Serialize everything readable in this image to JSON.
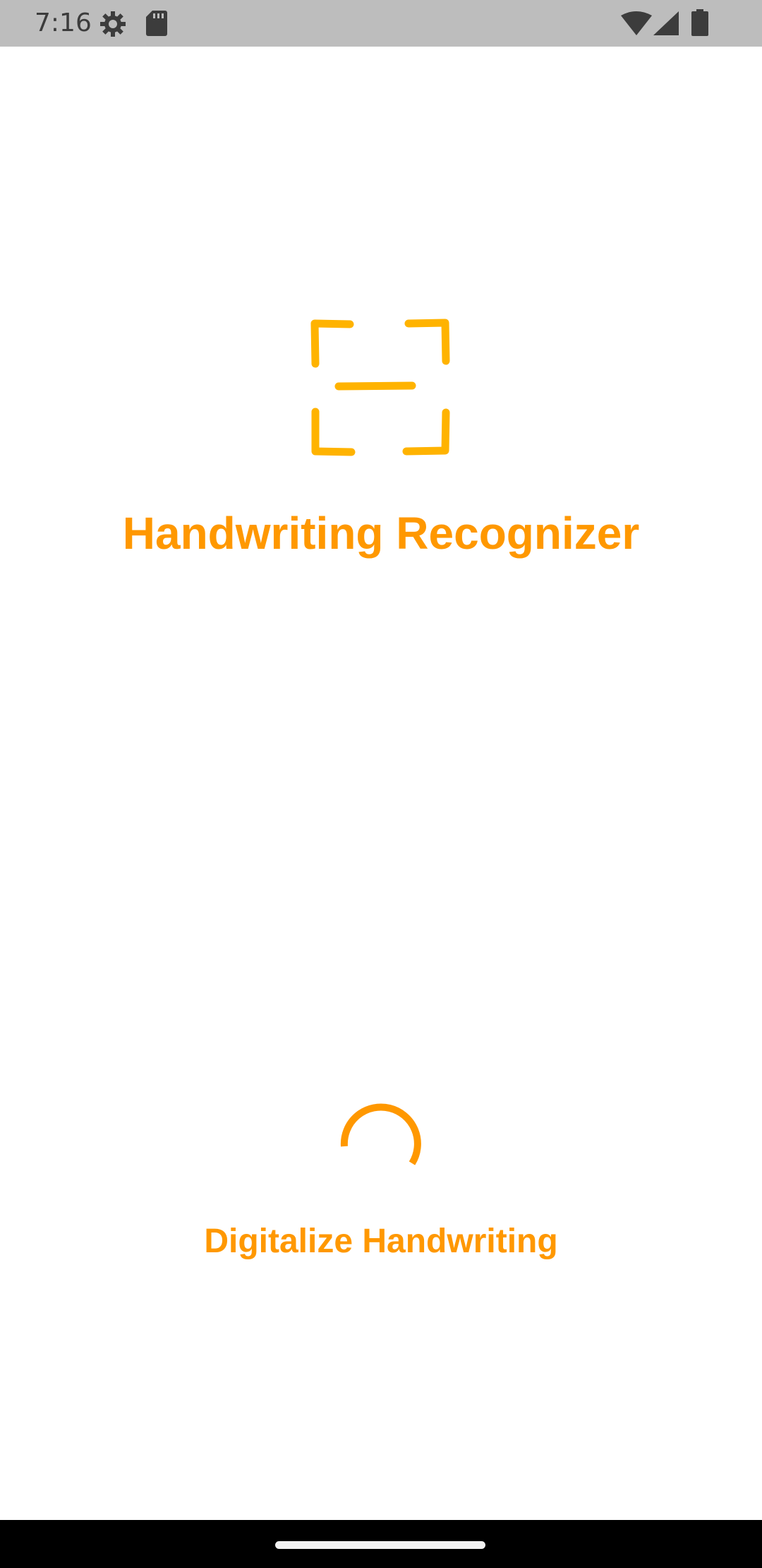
{
  "status_bar": {
    "time": "7:16",
    "icons": [
      "settings-gear-icon",
      "sd-card-icon",
      "wifi-icon",
      "cell-signal-icon",
      "battery-icon"
    ]
  },
  "splash": {
    "logo_icon": "scan-frame-icon",
    "title": "Handwriting Recognizer",
    "tagline": "Digitalize Handwriting",
    "loading": true
  },
  "colors": {
    "accent": "#ff9800",
    "logo": "#ffb300",
    "status_bar_bg": "#bdbdbd",
    "nav_bar_bg": "#000000"
  }
}
